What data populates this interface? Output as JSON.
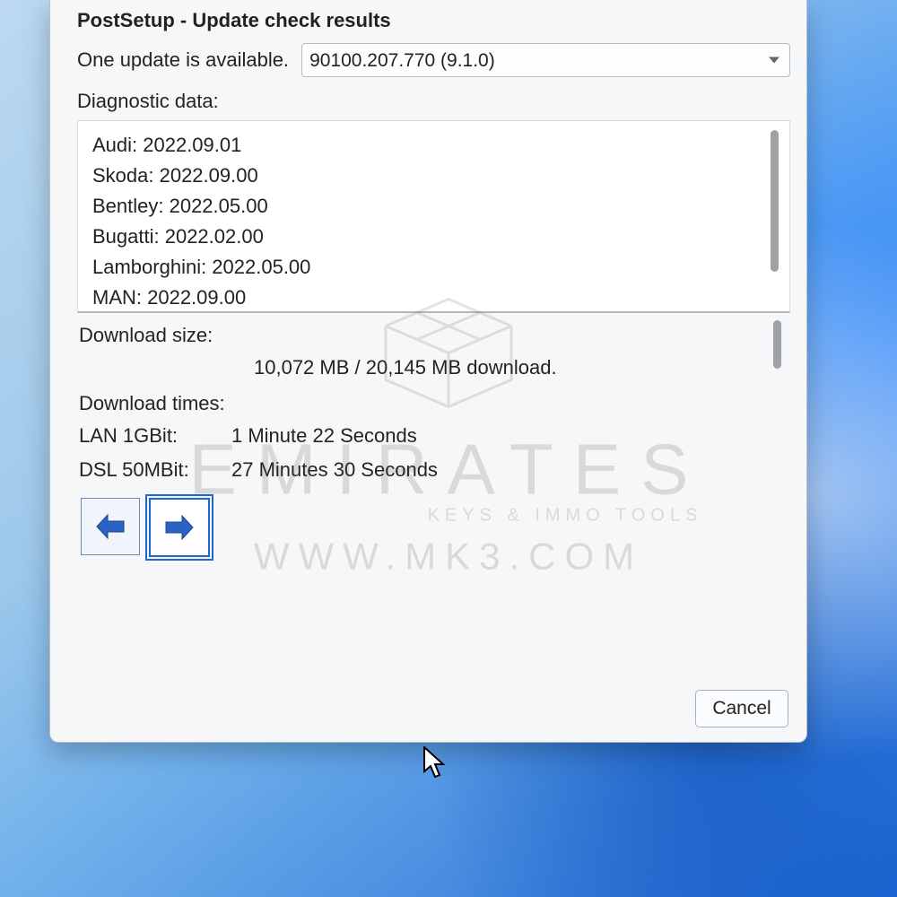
{
  "window": {
    "title": "PostSetup - Update check results",
    "available_label": "One update is available.",
    "version": "90100.207.770 (9.1.0)",
    "diag_label": "Diagnostic data:",
    "diag_items": [
      "Audi: 2022.09.01",
      "Skoda: 2022.09.00",
      "Bentley: 2022.05.00",
      "Bugatti: 2022.02.00",
      "Lamborghini: 2022.05.00",
      "MAN: 2022.09.00"
    ],
    "dl_size_label": "Download size:",
    "dl_size_value": "10,072 MB / 20,145 MB download.",
    "dl_times_label": "Download times:",
    "dl_rows": [
      {
        "label": "LAN 1GBit:",
        "value": "1 Minute 22 Seconds"
      },
      {
        "label": "DSL 50MBit:",
        "value": "27 Minutes 30 Seconds"
      }
    ],
    "cancel_label": "Cancel"
  },
  "watermark": {
    "line1": "EMIRATES",
    "line2": "KEYS & IMMO TOOLS",
    "line3": "WWW.MK3.COM"
  }
}
